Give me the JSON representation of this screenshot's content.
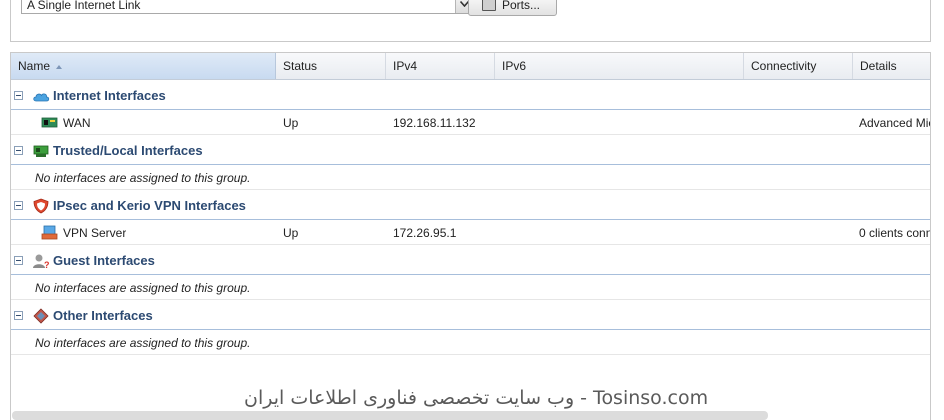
{
  "toolbar": {
    "connection_select_value": "A Single Internet Link",
    "ports_button_label": "Ports..."
  },
  "grid": {
    "columns": [
      "Name",
      "Status",
      "IPv4",
      "IPv6",
      "Connectivity",
      "Details"
    ],
    "groups": [
      {
        "title": "Internet Interfaces",
        "icon": "cloud-icon",
        "rows": [
          {
            "name": "WAN",
            "status": "Up",
            "ipv4": "192.168.11.132",
            "ipv6": "",
            "connectivity": "",
            "details": "Advanced Mic"
          }
        ]
      },
      {
        "title": "Trusted/Local Interfaces",
        "icon": "lan-icon",
        "empty_text": "No interfaces are assigned to this group."
      },
      {
        "title": "IPsec and Kerio VPN Interfaces",
        "icon": "shield-icon",
        "rows": [
          {
            "name": "VPN Server",
            "status": "Up",
            "ipv4": "172.26.95.1",
            "ipv6": "",
            "connectivity": "",
            "details": "0 clients conn"
          }
        ]
      },
      {
        "title": "Guest Interfaces",
        "icon": "guest-user-icon",
        "empty_text": "No interfaces are assigned to this group."
      },
      {
        "title": "Other Interfaces",
        "icon": "diamond-icon",
        "empty_text": "No interfaces are assigned to this group."
      }
    ]
  },
  "watermark": "وب سایت تخصصی فناوری اطلاعات ایران - Tosinso.com"
}
